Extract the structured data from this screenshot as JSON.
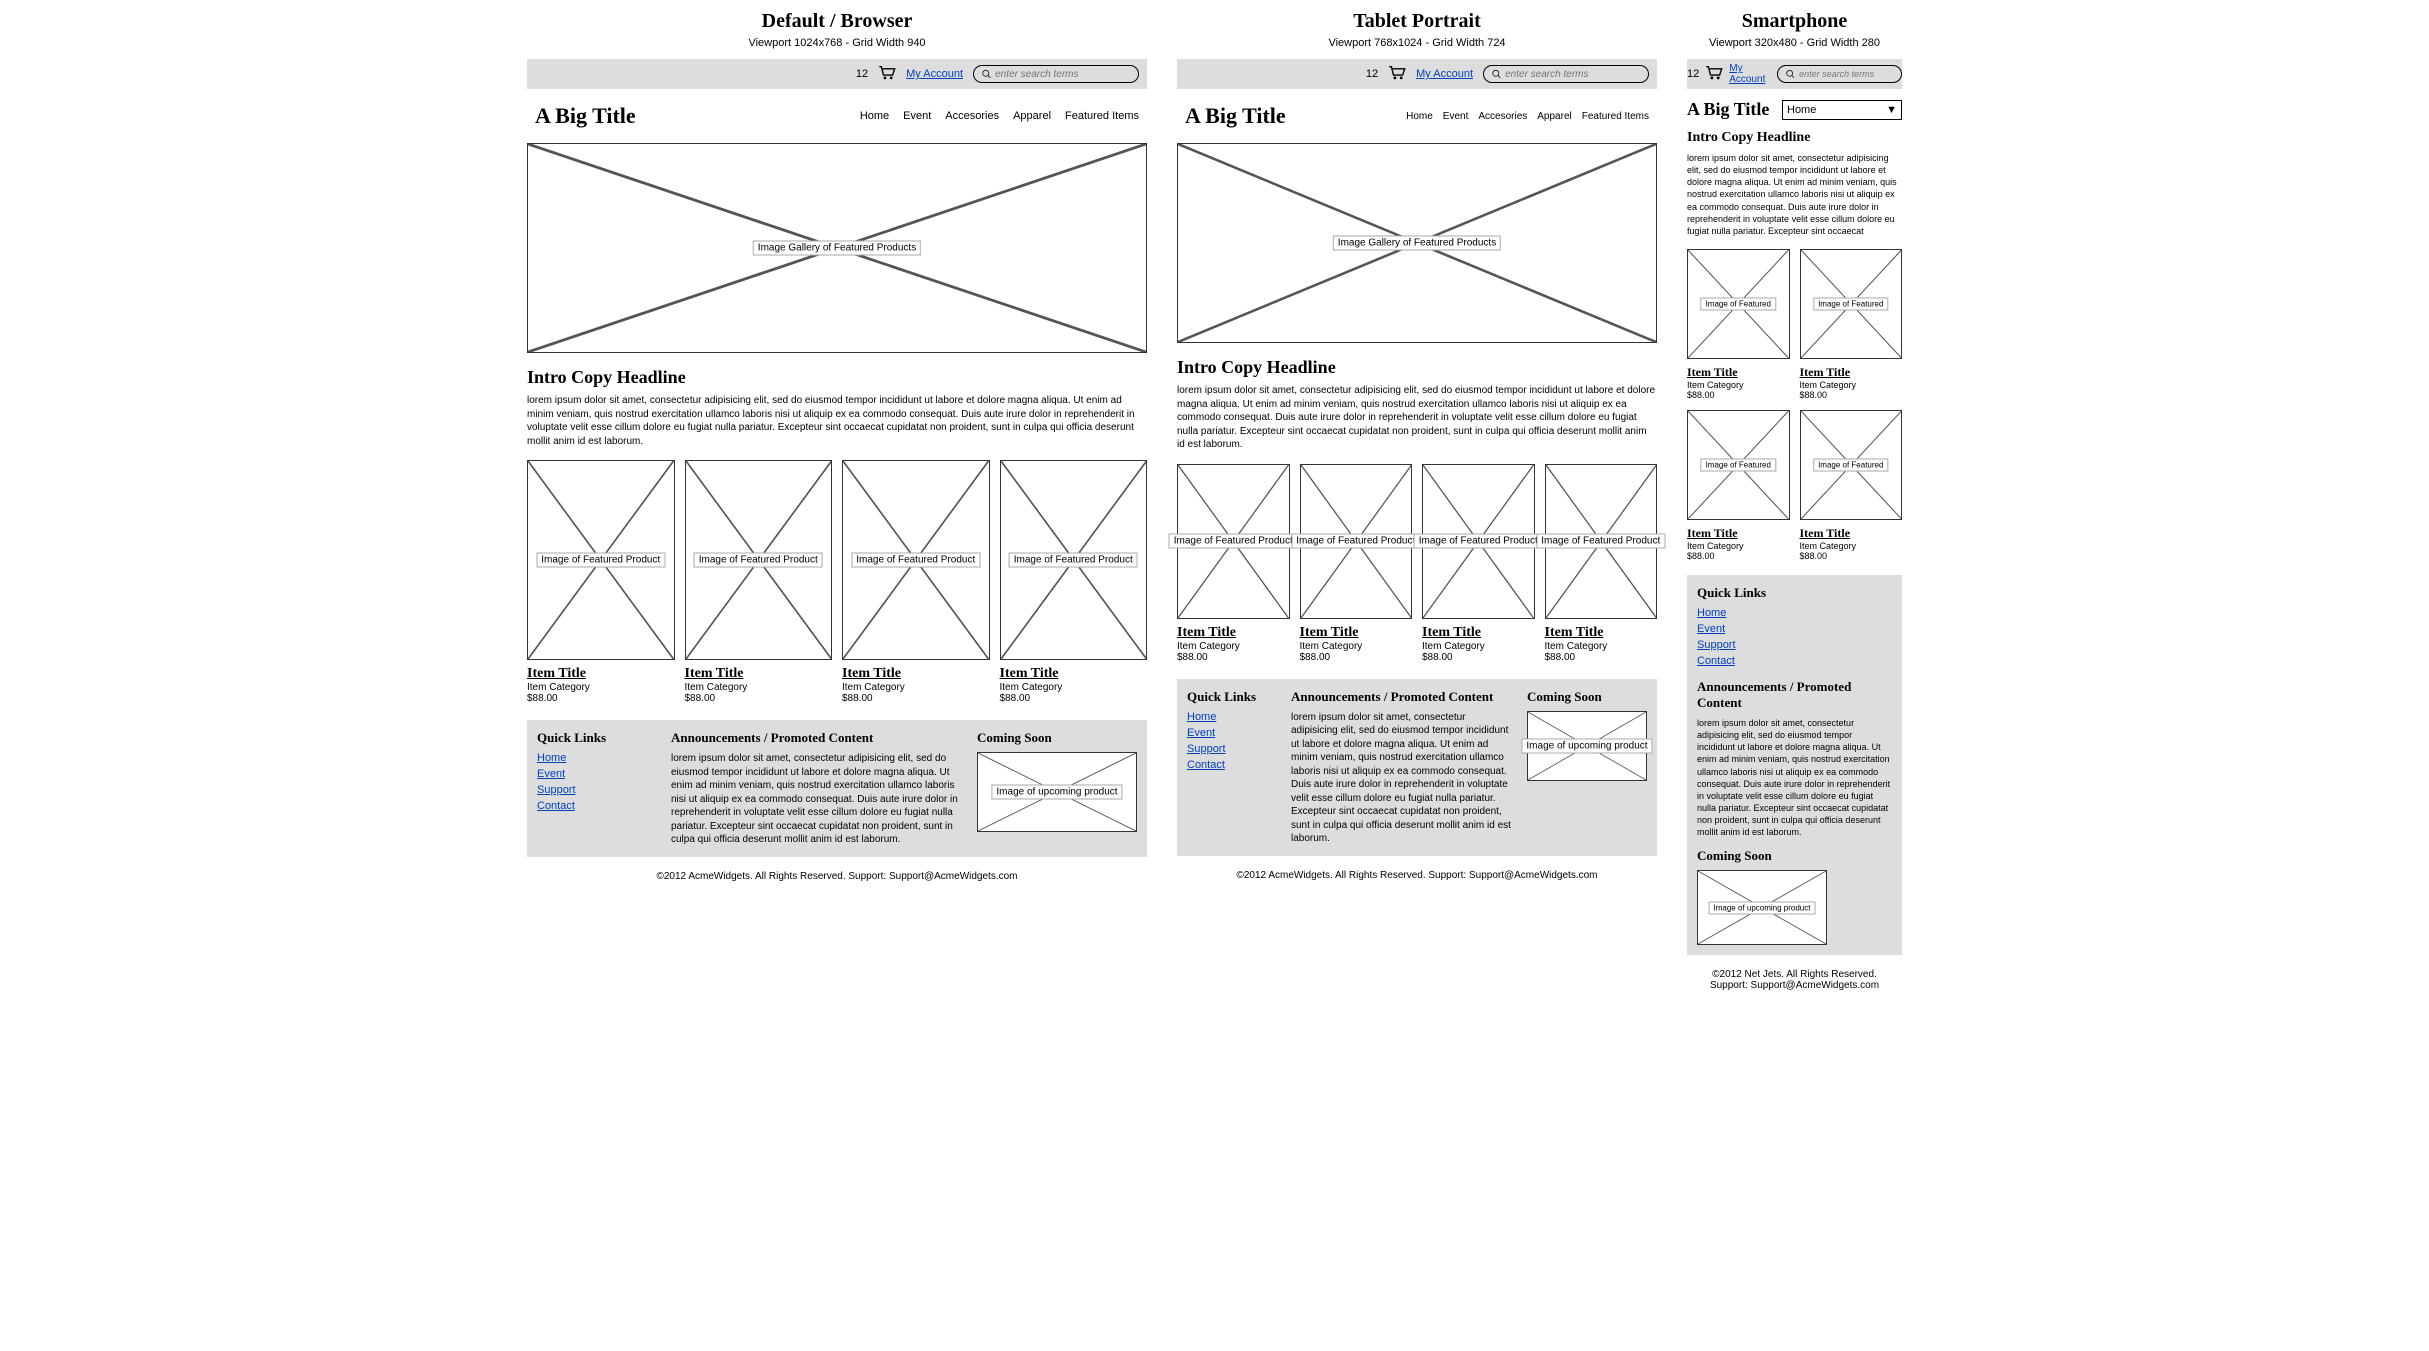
{
  "columns": {
    "desktop": {
      "title": "Default / Browser",
      "viewport": "Viewport 1024x768 - Grid Width 940"
    },
    "tablet": {
      "title": "Tablet Portrait",
      "viewport": "Viewport 768x1024 - Grid Width 724"
    },
    "phone": {
      "title": "Smartphone",
      "viewport": "Viewport 320x480 - Grid Width 280"
    }
  },
  "topbar": {
    "cart_count": "12",
    "account_link": "My Account",
    "search_placeholder": "enter search terms"
  },
  "header": {
    "title": "A Big Title",
    "nav": [
      "Home",
      "Event",
      "Accesories",
      "Apparel",
      "Featured Items"
    ],
    "nav_select_value": "Home"
  },
  "hero": {
    "label": "Image Gallery of Featured Products"
  },
  "intro": {
    "heading": "Intro Copy Headline",
    "body_long": "lorem ipsum dolor sit amet, consectetur adipisicing elit, sed do eiusmod tempor incididunt ut labore et dolore magna aliqua. Ut enim ad minim veniam, quis nostrud exercitation ullamco laboris nisi ut aliquip ex ea commodo consequat. Duis aute irure dolor in reprehenderit in voluptate velit esse cillum dolore eu fugiat nulla pariatur. Excepteur sint occaecat cupidatat non proident, sunt in culpa qui officia deserunt mollit anim id est laborum.",
    "body_med": "lorem ipsum dolor sit amet, consectetur adipisicing elit, sed do eiusmod tempor incididunt ut labore et dolore magna aliqua. Ut enim ad minim veniam, quis nostrud exercitation ullamco laboris nisi ut aliquip ex ea commodo consequat. Duis aute irure dolor in reprehenderit in voluptate velit esse cillum dolore eu fugiat nulla pariatur. Excepteur sint occaecat cupidatat non proident, sunt in culpa qui officia deserunt mollit anim id est laborum.",
    "body_short": "lorem ipsum dolor sit amet, consectetur adipisicing elit, sed do eiusmod tempor incididunt ut labore et dolore magna aliqua. Ut enim ad minim veniam, quis nostrud exercitation ullamco laboris nisi ut aliquip ex ea commodo consequat. Duis aute irure dolor in reprehenderit in voluptate velit esse cillum dolore eu fugiat nulla pariatur. Excepteur sint occaecat"
  },
  "product": {
    "img_label_full": "Image of Featured Product",
    "img_label_short": "Image of Featured",
    "title": "Item Title",
    "category": "Item Category",
    "price": "$88.00"
  },
  "promo": {
    "quick_links_heading": "Quick Links",
    "quick_links": [
      "Home",
      "Event",
      "Support",
      "Contact"
    ],
    "ann_heading": "Announcements / Promoted Content",
    "ann_body": "lorem ipsum dolor sit amet, consectetur adipisicing elit, sed do eiusmod tempor incididunt ut labore et dolore magna aliqua. Ut enim ad minim veniam, quis nostrud exercitation ullamco laboris nisi ut aliquip ex ea commodo consequat. Duis aute irure dolor in reprehenderit in voluptate velit esse cillum dolore eu fugiat nulla pariatur. Excepteur sint occaecat cupidatat non proident, sunt in culpa qui officia deserunt mollit anim id est laborum.",
    "soon_heading": "Coming Soon",
    "soon_img_label": "Image of upcoming product"
  },
  "footer": {
    "text_desktop": "©2012 AcmeWidgets.   All Rights Reserved.   Support: Support@AcmeWidgets.com",
    "text_tablet": "©2012 AcmeWidgets.   All Rights Reserved.   Support: Support@AcmeWidgets.com",
    "text_phone_line1": "©2012 Net Jets.   All Rights Reserved.",
    "text_phone_line2": "Support: Support@AcmeWidgets.com"
  }
}
